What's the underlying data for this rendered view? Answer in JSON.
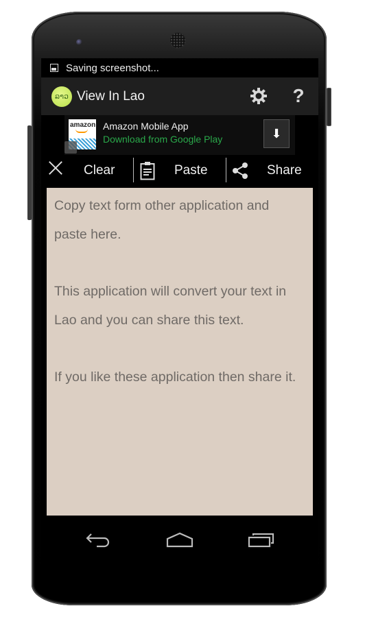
{
  "status_bar": {
    "notification_icon": "image-icon",
    "text": "Saving screenshot..."
  },
  "action_bar": {
    "logo_text": "ລາວ",
    "title": "View In Lao",
    "settings_icon": "gear-icon",
    "help_label": "?"
  },
  "ad": {
    "icon_brand": "amazon",
    "title": "Amazon Mobile App",
    "subtitle": "Download from Google Play",
    "download_icon": "download-arrow-icon",
    "download_glyph": "⬇"
  },
  "toolbar": {
    "clear_label": "Clear",
    "paste_label": "Paste",
    "share_label": "Share"
  },
  "content": {
    "paragraphs": [
      "Copy text form other application and paste here.",
      "This application will convert your text in Lao and you can share this text.",
      "If you like these application then share it."
    ]
  },
  "nav_bar": {
    "back": "back-icon",
    "home": "home-icon",
    "recents": "recents-icon"
  },
  "colors": {
    "content_bg": "#dccfc3",
    "content_text": "#6f6a66",
    "ad_subtitle": "#2aa84a",
    "logo_green": "#c8eb5a"
  }
}
